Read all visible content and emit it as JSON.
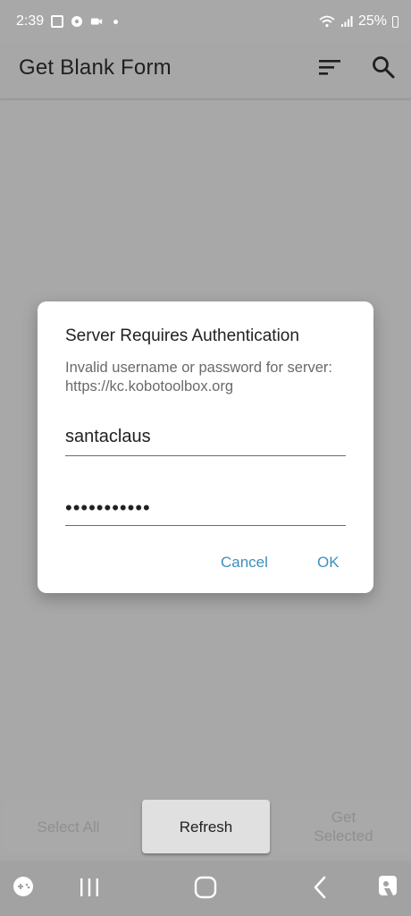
{
  "status_bar": {
    "time": "2:39",
    "battery": "25%",
    "icons": [
      "image-icon",
      "soccer-ball-icon",
      "video-call-icon",
      "notification-dot-icon",
      "wifi-icon",
      "signal-icon",
      "battery-icon"
    ]
  },
  "app_bar": {
    "title": "Get Blank Form",
    "icons": [
      "sort-icon",
      "search-icon"
    ]
  },
  "dialog": {
    "title": "Server Requires Authentication",
    "message": "Invalid username or password for server: https://kc.kobotoolbox.org",
    "username_value": "santaclaus",
    "password_value": "•••••••••••",
    "cancel_label": "Cancel",
    "ok_label": "OK"
  },
  "bottom_buttons": {
    "select_all": "Select All",
    "refresh": "Refresh",
    "get_selected": "Get Selected"
  },
  "nav_bar": {
    "icons": [
      "game-launcher-icon",
      "recent-apps-icon",
      "home-icon",
      "back-icon",
      "accessibility-icon"
    ]
  },
  "colors": {
    "scrim_background": "#a8a8a8",
    "dialog_background": "#ffffff",
    "accent": "#3d8fbd",
    "text_primary": "#212121",
    "text_secondary": "#6a6a6a"
  }
}
